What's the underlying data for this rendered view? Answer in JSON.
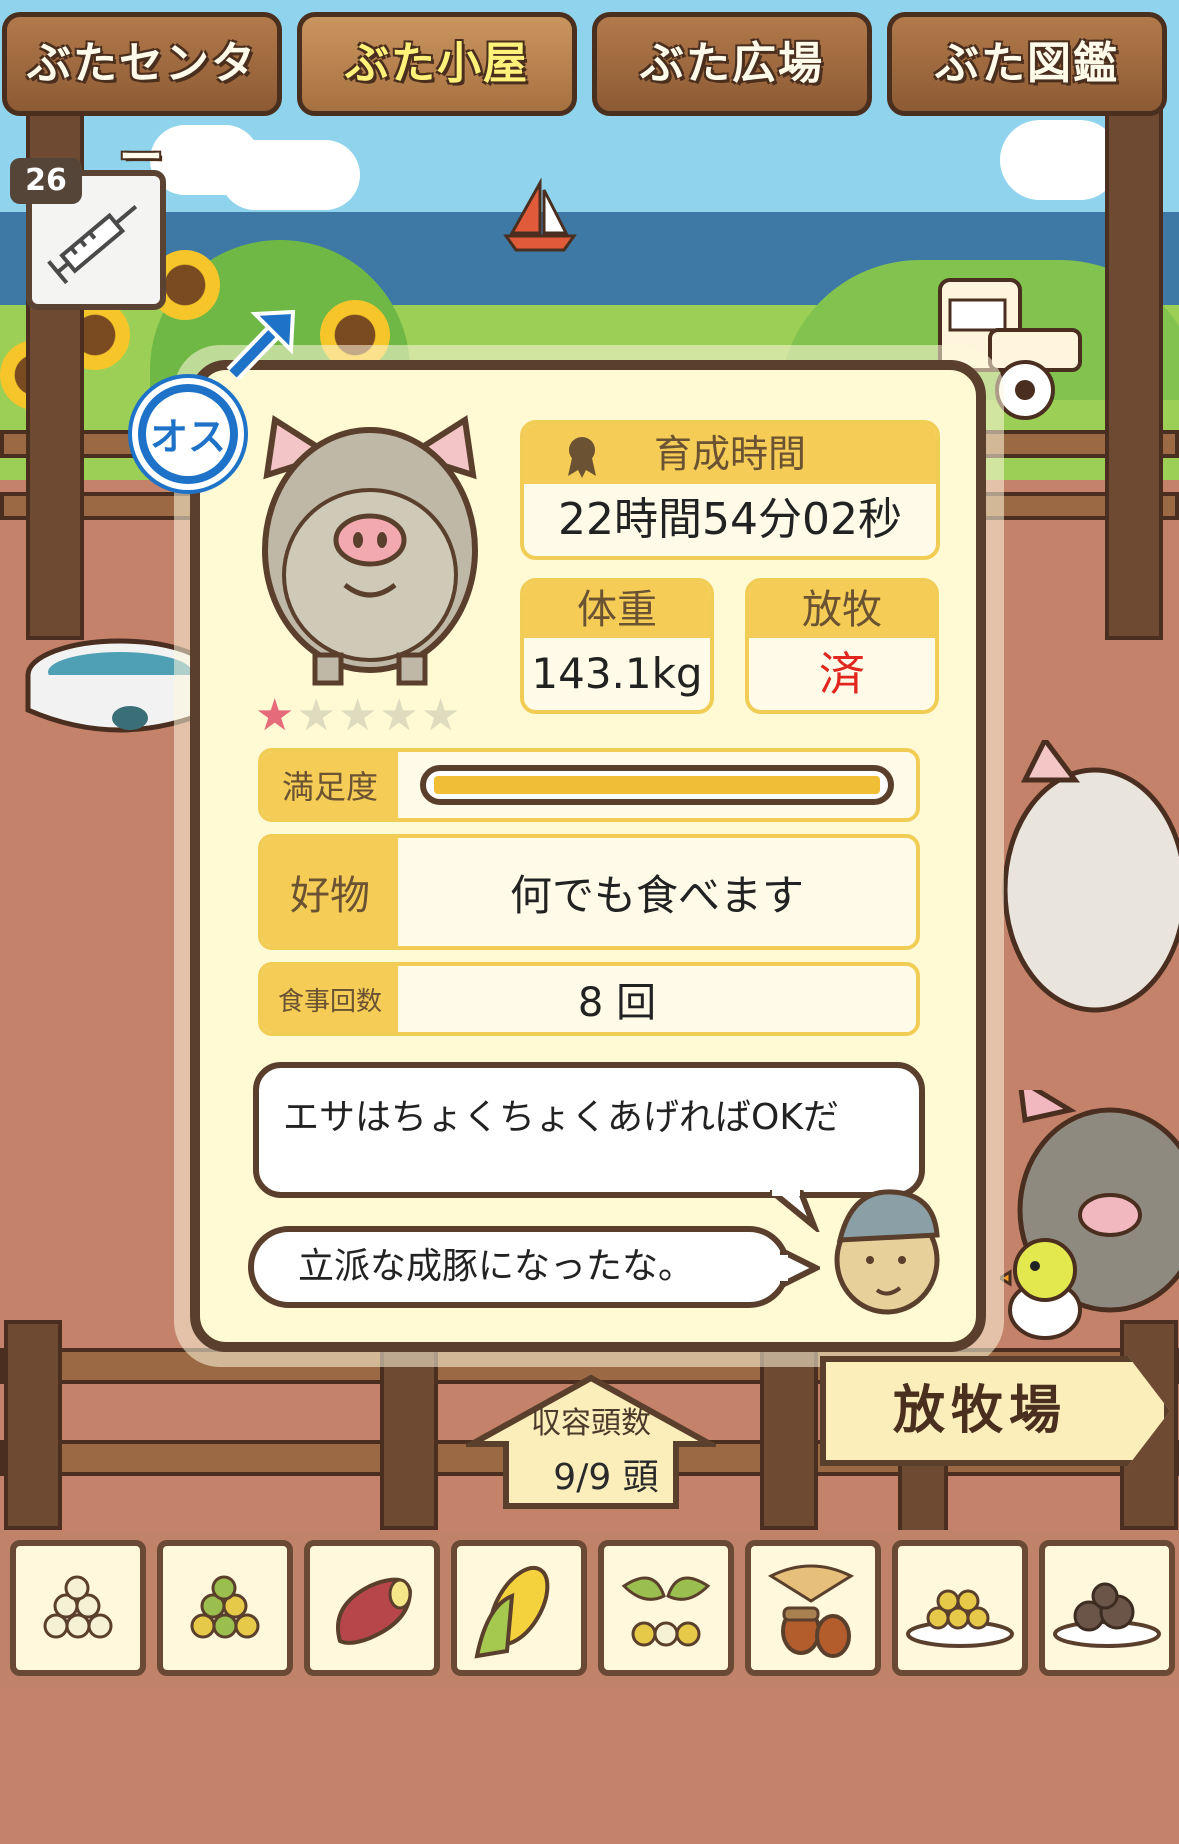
{
  "tabs": [
    {
      "label": "ぶたセンター",
      "active": false
    },
    {
      "label": "ぶた小屋",
      "active": true
    },
    {
      "label": "ぶた広場",
      "active": false
    },
    {
      "label": "ぶた図鑑",
      "active": false
    }
  ],
  "syringe": {
    "count": "26",
    "icon": "syringe-icon"
  },
  "pig": {
    "gender_label": "オス",
    "gender_symbol": "♂",
    "rating": 1,
    "rating_max": 5,
    "raise_time_label": "育成時間",
    "raise_time_value": "22時間54分02秒",
    "weight_label": "体重",
    "weight_value": "143.1kg",
    "grazing_label": "放牧",
    "grazing_value": "済",
    "satisfaction_label": "満足度",
    "satisfaction_level": 1.0,
    "favorite_label": "好物",
    "favorite_value": "何でも食べます",
    "meals_label": "食事回数",
    "meals_value": "8 回"
  },
  "dialog": {
    "hint": "エサはちょくちょくあげればOKだ",
    "comment": "立派な成豚になったな。"
  },
  "capacity": {
    "label": "収容頭数",
    "value": "9/9 頭"
  },
  "pasture_sign": "放牧場",
  "foods": [
    {
      "name": "beans-white"
    },
    {
      "name": "beans-mixed"
    },
    {
      "name": "sweet-potato"
    },
    {
      "name": "corn"
    },
    {
      "name": "herb-beans"
    },
    {
      "name": "acorn"
    },
    {
      "name": "bean-plate"
    },
    {
      "name": "truffle-plate"
    }
  ],
  "colors": {
    "accent": "#f5cc55",
    "frame": "#5a3f2c",
    "grazing_done": "#e0261e",
    "gender": "#1e73c8"
  }
}
